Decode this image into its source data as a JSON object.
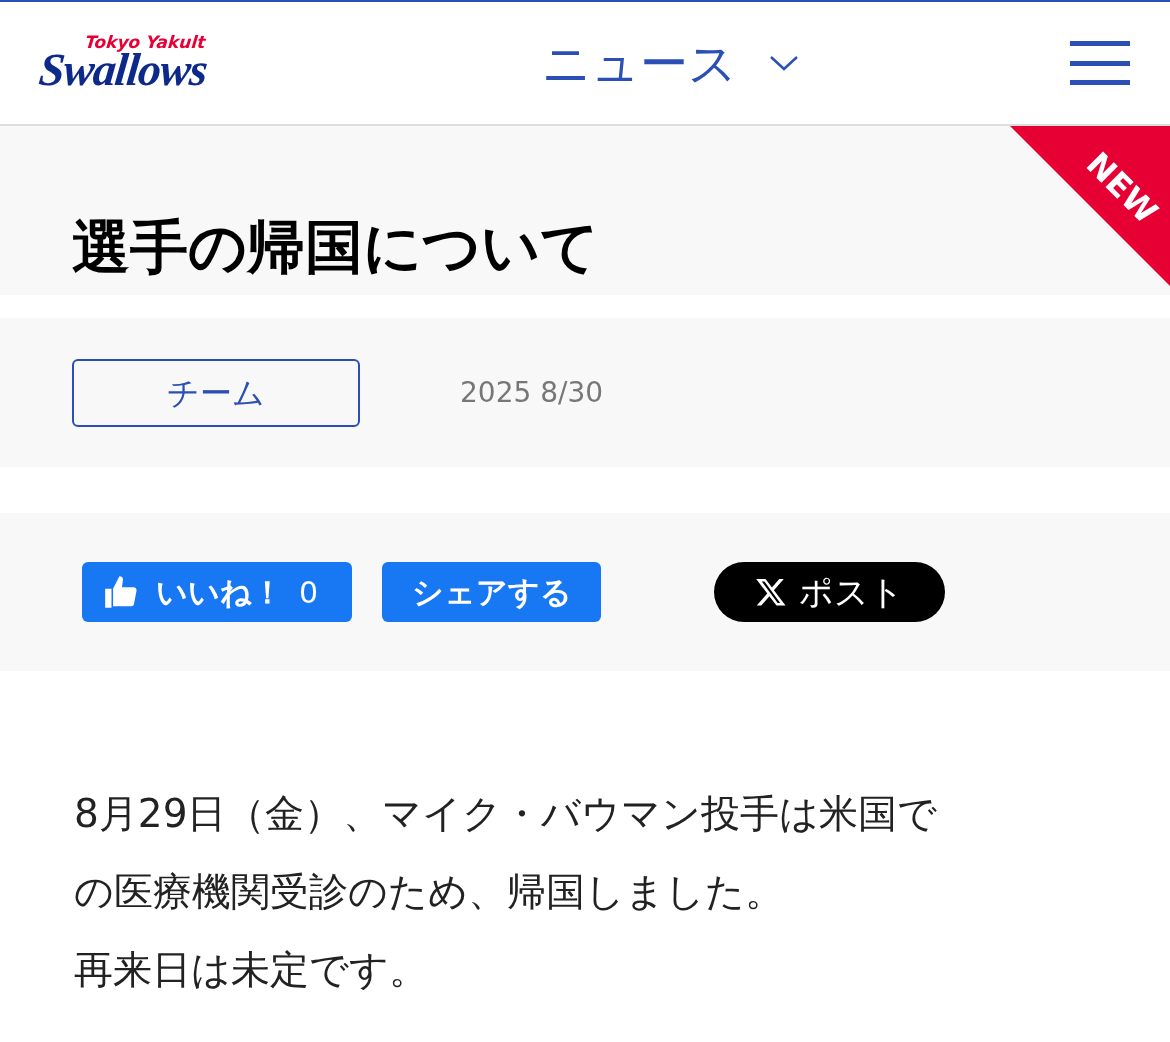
{
  "header": {
    "logo": {
      "top": "Tokyo Yakult",
      "main": "Swallows"
    },
    "section_menu": {
      "label": "ニュース",
      "expanded": false
    }
  },
  "article": {
    "title": "選手の帰国について",
    "is_new": true,
    "new_badge": "NEW",
    "category": "チーム",
    "date": "2025 8/30",
    "share": {
      "like_label": "いいね！",
      "like_count": "0",
      "share_label": "シェアする",
      "post_label": "ポスト"
    },
    "body": [
      "8月29日（金）、マイク・バウマン投手は米国での医療機関受診のため、帰国しました。",
      "再来日は未定です。"
    ]
  }
}
